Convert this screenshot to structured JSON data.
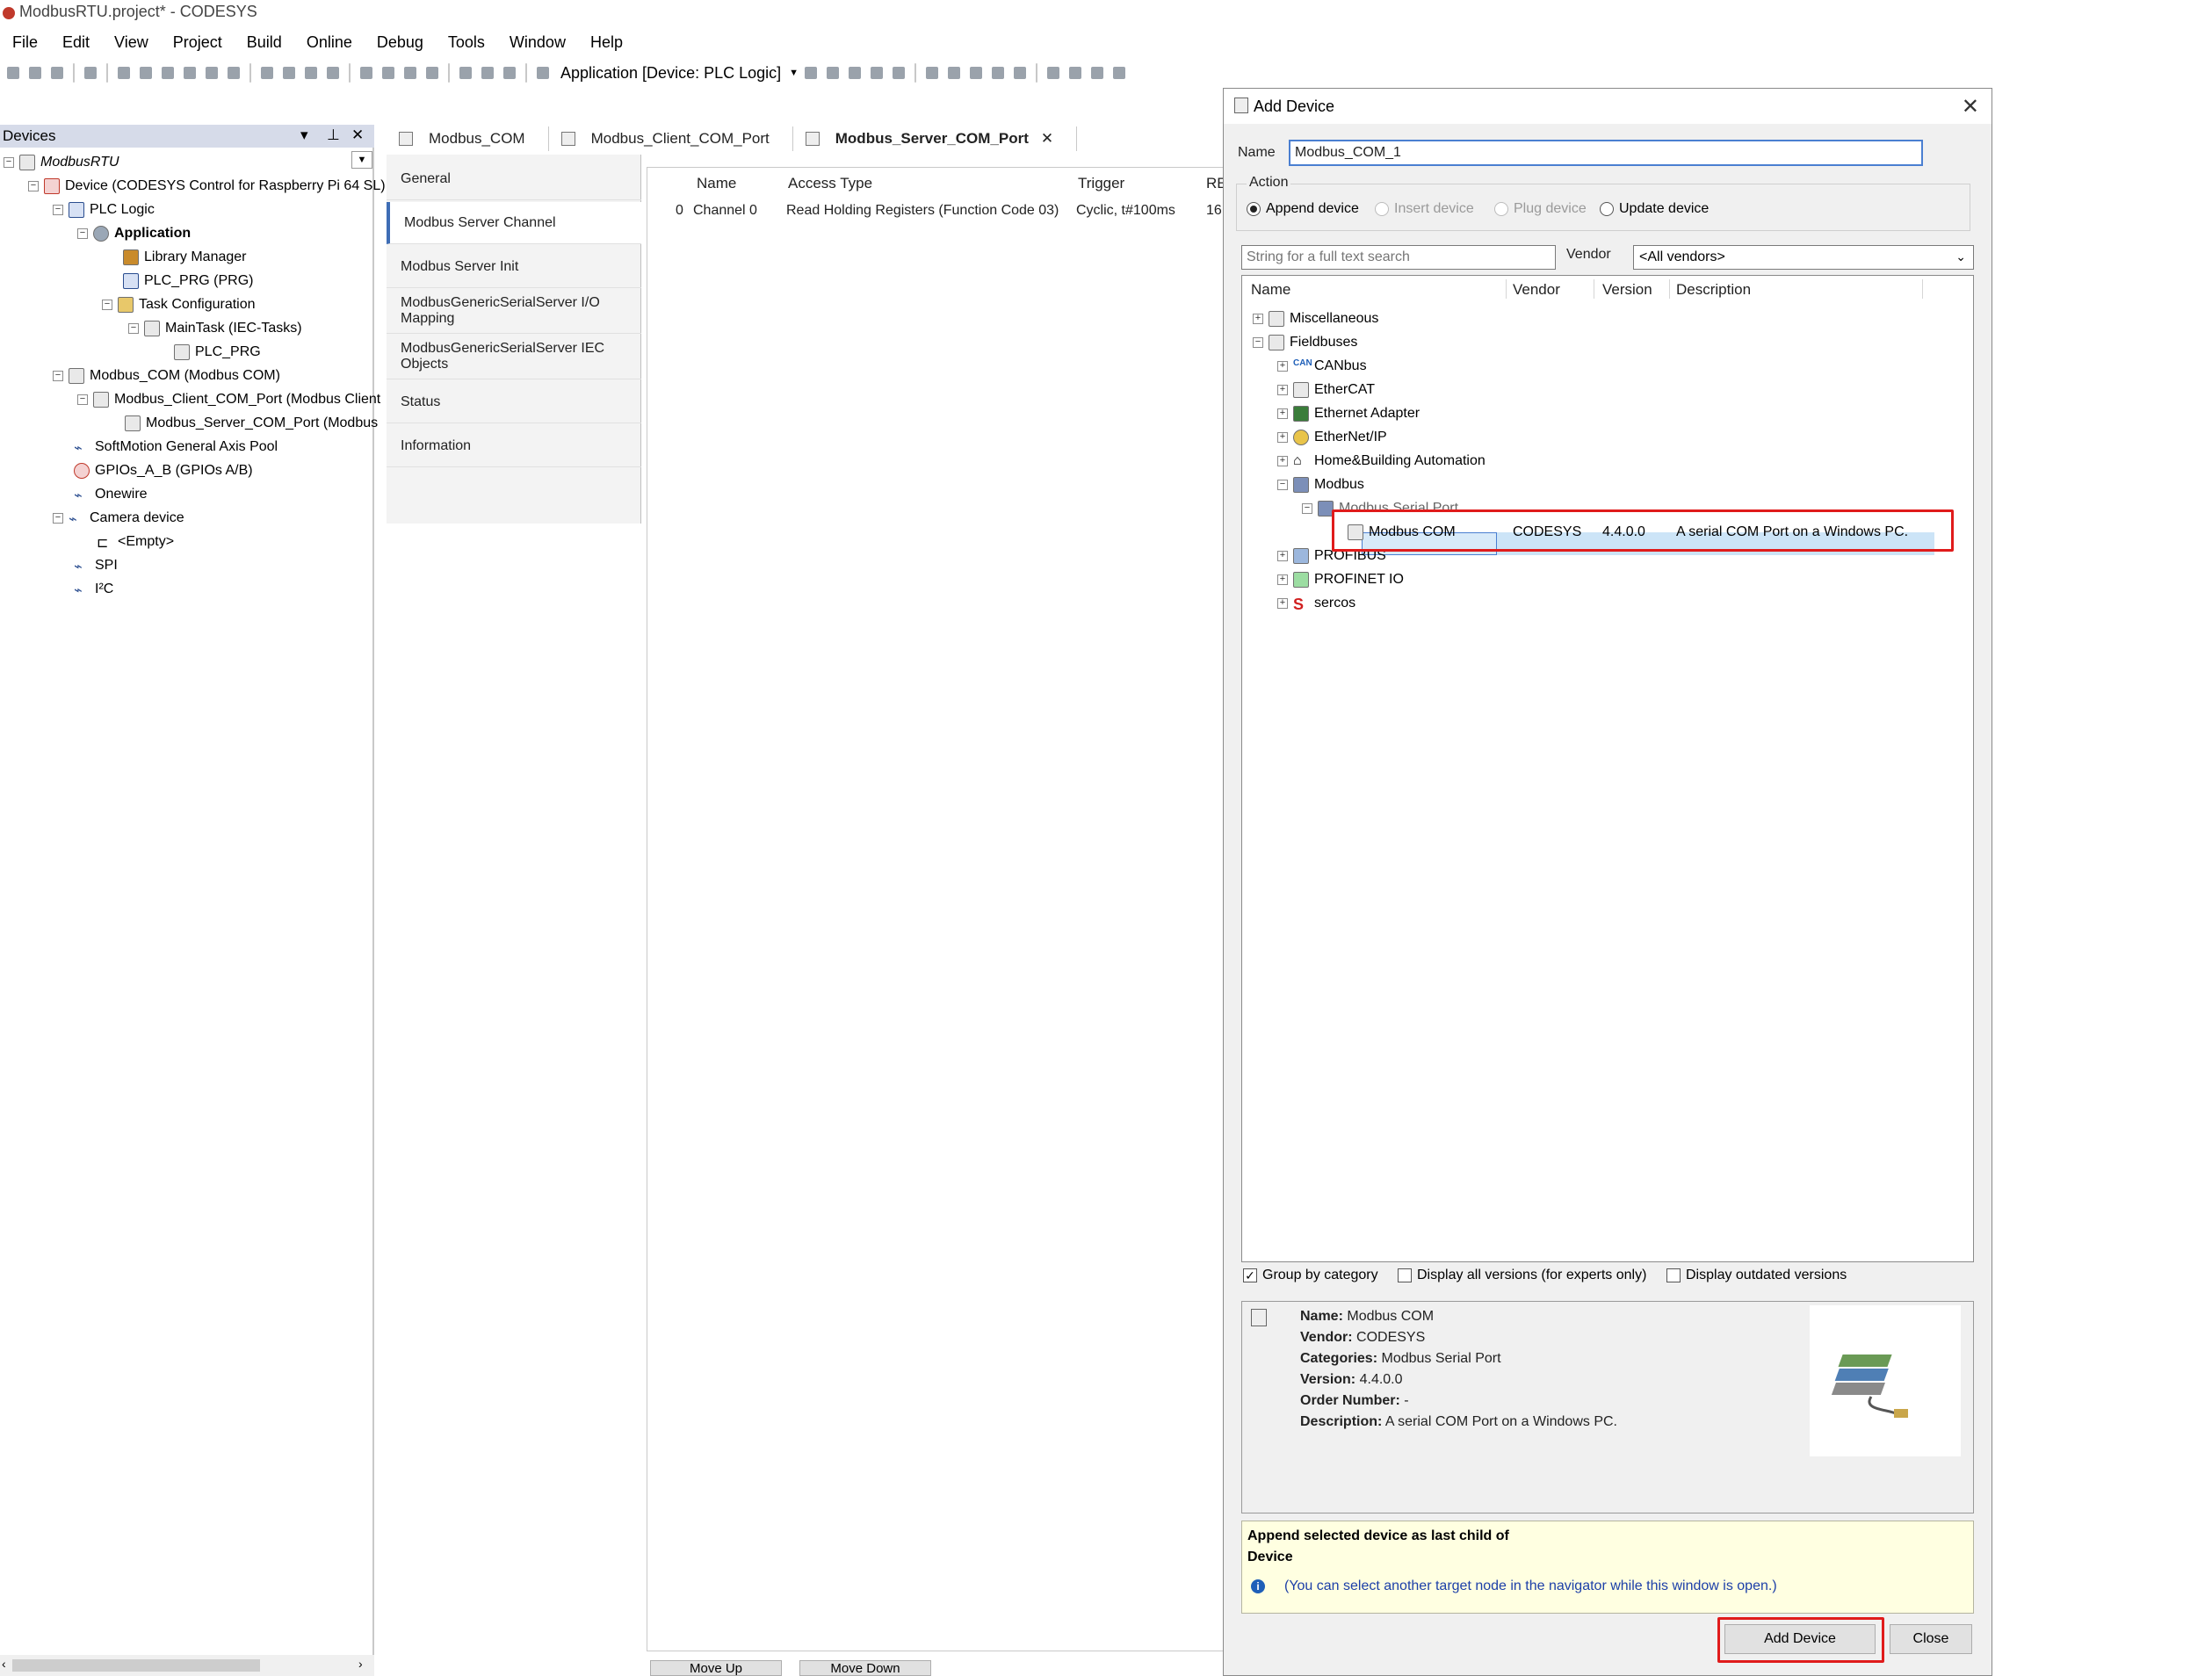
{
  "window": {
    "title": "ModbusRTU.project* - CODESYS"
  },
  "menubar": [
    "File",
    "Edit",
    "View",
    "Project",
    "Build",
    "Online",
    "Debug",
    "Tools",
    "Window",
    "Help"
  ],
  "toolbar": {
    "application_label": "Application [Device: PLC Logic]"
  },
  "devices_pane": {
    "title": "Devices",
    "tree": [
      {
        "label": "ModbusRTU",
        "italic": true
      },
      {
        "label": "Device (CODESYS Control for Raspberry Pi 64 SL)"
      },
      {
        "label": "PLC Logic"
      },
      {
        "label": "Application",
        "bold": true
      },
      {
        "label": "Library Manager"
      },
      {
        "label": "PLC_PRG (PRG)"
      },
      {
        "label": "Task Configuration"
      },
      {
        "label": "MainTask (IEC-Tasks)"
      },
      {
        "label": "PLC_PRG"
      },
      {
        "label": "Modbus_COM (Modbus COM)"
      },
      {
        "label": "Modbus_Client_COM_Port (Modbus Client"
      },
      {
        "label": "Modbus_Server_COM_Port (Modbus"
      },
      {
        "label": "SoftMotion General Axis Pool"
      },
      {
        "label": "GPIOs_A_B (GPIOs A/B)"
      },
      {
        "label": "Onewire"
      },
      {
        "label": "Camera device"
      },
      {
        "label": "<Empty>"
      },
      {
        "label": "SPI"
      },
      {
        "label": "I²C"
      }
    ]
  },
  "editor_tabs": [
    {
      "label": "Modbus_COM"
    },
    {
      "label": "Modbus_Client_COM_Port"
    },
    {
      "label": "Modbus_Server_COM_Port",
      "active": true
    }
  ],
  "editor_nav": [
    {
      "label": "General"
    },
    {
      "label": "Modbus Server Channel",
      "active": true
    },
    {
      "label": "Modbus Server Init"
    },
    {
      "label": "ModbusGenericSerialServer I/O Mapping"
    },
    {
      "label": "ModbusGenericSerialServer IEC Objects"
    },
    {
      "label": "Status"
    },
    {
      "label": "Information"
    }
  ],
  "channel_table": {
    "headers": [
      "Name",
      "Access Type",
      "Trigger",
      "RE"
    ],
    "rows": [
      {
        "index": "0",
        "name": "Channel 0",
        "access": "Read Holding Registers (Function Code 03)",
        "trigger": "Cyclic, t#100ms",
        "re": "16"
      }
    ]
  },
  "editor_buttons": {
    "move_up": "Move Up",
    "move_down": "Move Down"
  },
  "dialog": {
    "title": "Add Device",
    "name_label": "Name",
    "name_value": "Modbus_COM_1",
    "action_label": "Action",
    "actions": [
      {
        "label": "Append device",
        "checked": true,
        "enabled": true
      },
      {
        "label": "Insert device",
        "checked": false,
        "enabled": false
      },
      {
        "label": "Plug device",
        "checked": false,
        "enabled": false
      },
      {
        "label": "Update device",
        "checked": false,
        "enabled": true
      }
    ],
    "search_placeholder": "String for a full text search",
    "vendor_label": "Vendor",
    "vendor_value": "<All vendors>",
    "columns": [
      "Name",
      "Vendor",
      "Version",
      "Description"
    ],
    "tree": [
      {
        "label": "Miscellaneous"
      },
      {
        "label": "Fieldbuses"
      },
      {
        "label": "CANbus"
      },
      {
        "label": "EtherCAT"
      },
      {
        "label": "Ethernet Adapter"
      },
      {
        "label": "EtherNet/IP"
      },
      {
        "label": "Home&Building Automation"
      },
      {
        "label": "Modbus"
      },
      {
        "label": "Modbus Serial Port"
      },
      {
        "label": "Modbus COM",
        "vendor": "CODESYS",
        "version": "4.4.0.0",
        "description": "A serial COM Port on a Windows PC.",
        "selected": true
      },
      {
        "label": "PROFIBUS"
      },
      {
        "label": "PROFINET IO"
      },
      {
        "label": "sercos"
      }
    ],
    "options": [
      {
        "label": "Group by category",
        "checked": true
      },
      {
        "label": "Display all versions (for experts only)",
        "checked": false
      },
      {
        "label": "Display outdated versions",
        "checked": false
      }
    ],
    "info": {
      "name_k": "Name:",
      "name_v": "Modbus COM",
      "vendor_k": "Vendor:",
      "vendor_v": "CODESYS",
      "categories_k": "Categories:",
      "categories_v": "Modbus Serial Port",
      "version_k": "Version:",
      "version_v": "4.4.0.0",
      "order_k": "Order Number:",
      "order_v": "-",
      "desc_k": "Description:",
      "desc_v": "A serial COM Port on a Windows PC."
    },
    "note_line1": "Append selected device as last child of",
    "note_line2": "Device",
    "note_hint": "(You can select another target node in the navigator while this window is open.)",
    "add_button": "Add Device",
    "close_button": "Close",
    "highlight_color": "#e01b1b",
    "selection_color": "#cce4f7"
  }
}
